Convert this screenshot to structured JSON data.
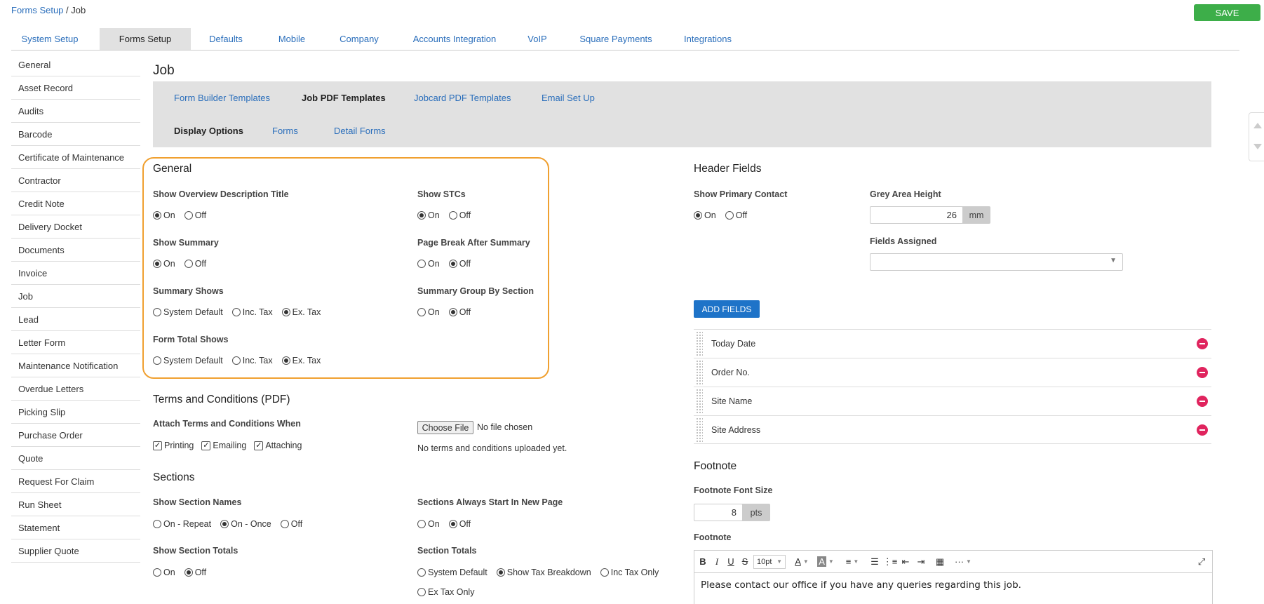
{
  "breadcrumb": {
    "parent": "Forms Setup",
    "separator": " / ",
    "current": "Job"
  },
  "save_label": "SAVE",
  "top_tabs": [
    "System Setup",
    "Forms Setup",
    "Defaults",
    "Mobile",
    "Company",
    "Accounts Integration",
    "VoIP",
    "Square Payments",
    "Integrations"
  ],
  "active_top_tab": "Forms Setup",
  "sidebar": [
    "General",
    "Asset Record",
    "Audits",
    "Barcode",
    "Certificate of Maintenance",
    "Contractor",
    "Credit Note",
    "Delivery Docket",
    "Documents",
    "Invoice",
    "Job",
    "Lead",
    "Letter Form",
    "Maintenance Notification",
    "Overdue Letters",
    "Picking Slip",
    "Purchase Order",
    "Quote",
    "Request For Claim",
    "Run Sheet",
    "Statement",
    "Supplier Quote"
  ],
  "page_title": "Job",
  "sub_tabs_row1": [
    "Form Builder Templates",
    "Job PDF Templates",
    "Jobcard PDF Templates",
    "Email Set Up"
  ],
  "sub_tabs_row2": [
    "Display Options",
    "Forms",
    "Detail Forms"
  ],
  "general": {
    "title": "General",
    "show_overview": {
      "label": "Show Overview Description Title",
      "options": [
        "On",
        "Off"
      ],
      "selected": "On"
    },
    "show_stcs": {
      "label": "Show STCs",
      "options": [
        "On",
        "Off"
      ],
      "selected": "On"
    },
    "show_summary": {
      "label": "Show Summary",
      "options": [
        "On",
        "Off"
      ],
      "selected": "On"
    },
    "page_break": {
      "label": "Page Break After Summary",
      "options": [
        "On",
        "Off"
      ],
      "selected": "Off"
    },
    "summary_shows": {
      "label": "Summary Shows",
      "options": [
        "System Default",
        "Inc. Tax",
        "Ex. Tax"
      ],
      "selected": "Ex. Tax"
    },
    "summary_group": {
      "label": "Summary Group By Section",
      "options": [
        "On",
        "Off"
      ],
      "selected": "Off"
    },
    "form_total": {
      "label": "Form Total Shows",
      "options": [
        "System Default",
        "Inc. Tax",
        "Ex. Tax"
      ],
      "selected": "Ex. Tax"
    }
  },
  "terms": {
    "title": "Terms and Conditions (PDF)",
    "attach_label": "Attach Terms and Conditions When",
    "checks": [
      {
        "label": "Printing",
        "checked": true
      },
      {
        "label": "Emailing",
        "checked": true
      },
      {
        "label": "Attaching",
        "checked": true
      }
    ],
    "choose_file": "Choose File",
    "no_file": "No file chosen",
    "none_uploaded": "No terms and conditions uploaded yet."
  },
  "sections": {
    "title": "Sections",
    "show_names": {
      "label": "Show Section Names",
      "options": [
        "On - Repeat",
        "On - Once",
        "Off"
      ],
      "selected": "On - Once"
    },
    "always_new_page": {
      "label": "Sections Always Start In New Page",
      "options": [
        "On",
        "Off"
      ],
      "selected": "Off"
    },
    "show_totals": {
      "label": "Show Section Totals",
      "options": [
        "On",
        "Off"
      ],
      "selected": "Off"
    },
    "section_totals": {
      "label": "Section Totals",
      "options": [
        "System Default",
        "Show Tax Breakdown",
        "Inc Tax Only",
        "Ex Tax Only"
      ],
      "selected": "Show Tax Breakdown"
    }
  },
  "header_fields": {
    "title": "Header Fields",
    "primary_contact": {
      "label": "Show Primary Contact",
      "options": [
        "On",
        "Off"
      ],
      "selected": "On"
    },
    "grey_area": {
      "label": "Grey Area Height",
      "value": "26",
      "unit": "mm"
    },
    "fields_assigned_label": "Fields Assigned",
    "add_fields": "ADD FIELDS",
    "fields": [
      "Today Date",
      "Order No.",
      "Site Name",
      "Site Address"
    ]
  },
  "footnote": {
    "title": "Footnote",
    "font_size_label": "Footnote Font Size",
    "font_size": "8",
    "font_unit": "pts",
    "footnote_label": "Footnote",
    "font_select": "10pt",
    "text": "Please contact our office if you have any queries regarding this job."
  }
}
